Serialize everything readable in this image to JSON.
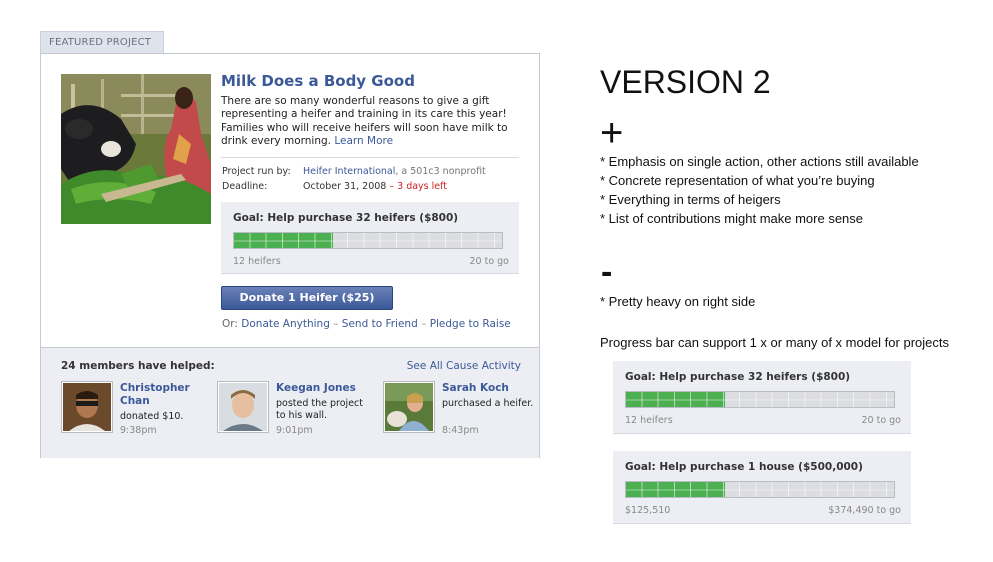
{
  "featured_tab": "FEATURED PROJECT",
  "project": {
    "title": "Milk Does a Body Good",
    "description": "There are so many wonderful reasons to give a gift representing a heifer and training in its care this year! Families who will receive heifers will soon have milk to drink every morning.",
    "learn_more": "Learn More",
    "run_by_label": "Project run by:",
    "run_by_org": "Heifer International",
    "run_by_suffix": ", a 501c3 nonprofit",
    "deadline_label": "Deadline:",
    "deadline_date": "October 31, 2008",
    "deadline_sep": " – ",
    "deadline_left": "3 days left"
  },
  "goal": {
    "title": "Goal: Help purchase 32 heifers ($800)",
    "progress": 0.37,
    "left_label": "12 heifers",
    "right_label": "20 to go"
  },
  "actions": {
    "donate_button": "Donate 1 Heifer ($25)",
    "or_label": "Or:",
    "donate_anything": "Donate Anything",
    "send_to_friend": "Send to Friend",
    "pledge_to_raise": "Pledge to Raise",
    "separator": " – "
  },
  "members": {
    "count_label": "24 members have helped:",
    "see_all": "See All Cause Activity",
    "items": [
      {
        "name": "Christopher Chan",
        "action": "donated $10.",
        "time": "9:38pm"
      },
      {
        "name": "Keegan Jones",
        "action": "posted the project to his wall.",
        "time": "9:01pm"
      },
      {
        "name": "Sarah Koch",
        "action": "purchased a heifer.",
        "time": "8:43pm"
      }
    ]
  },
  "notes": {
    "version": "VERSION 2",
    "plus_symbol": "+",
    "pros": [
      "* Emphasis on single action, other actions still available",
      "* Concrete representation of what you’re buying",
      "* Everything in terms of heigers",
      "* List of contributions might make more sense"
    ],
    "minus_symbol": "-",
    "cons": [
      "* Pretty heavy on right side"
    ],
    "progress_note": "Progress bar can support 1 x or many of x model for projects"
  },
  "examples": [
    {
      "title": "Goal: Help purchase 32 heifers ($800)",
      "progress": 0.37,
      "left_label": "12 heifers",
      "right_label": "20 to go"
    },
    {
      "title": "Goal: Help purchase 1 house ($500,000)",
      "progress": 0.37,
      "left_label": "$125,510",
      "right_label": "$374,490 to go"
    }
  ],
  "colors": {
    "brand_blue": "#3b5998",
    "progress_green": "#4caf50",
    "deadline_red": "#cc2222",
    "panel_gray": "#eceef3"
  }
}
